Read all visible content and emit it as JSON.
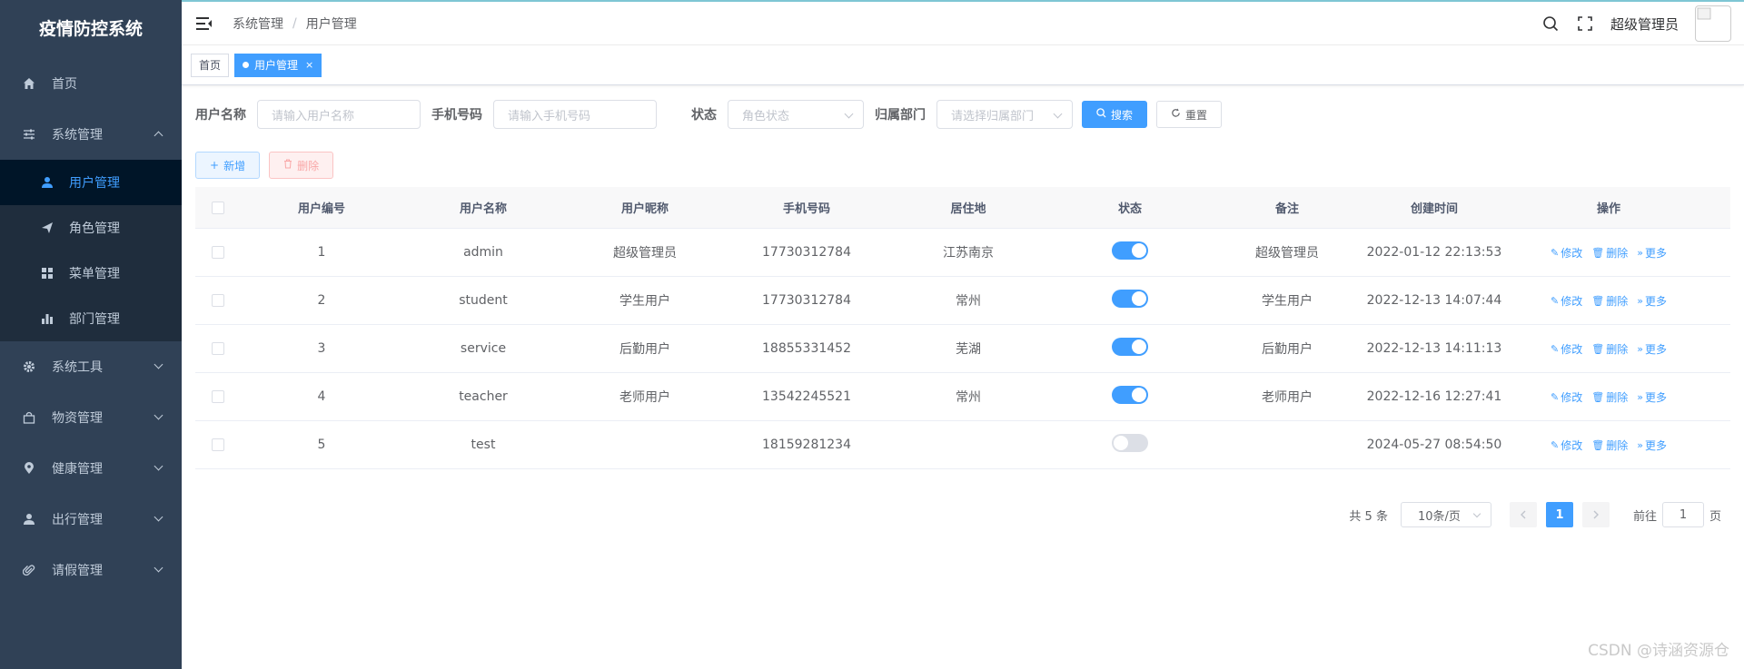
{
  "app": {
    "title": "疫情防控系统"
  },
  "sidebar": {
    "items": [
      {
        "label": "首页",
        "icon": "home-icon"
      },
      {
        "label": "系统管理",
        "icon": "sliders-icon",
        "expanded": true,
        "children": [
          {
            "label": "用户管理",
            "icon": "user-icon",
            "active": true
          },
          {
            "label": "角色管理",
            "icon": "send-icon"
          },
          {
            "label": "菜单管理",
            "icon": "grid-icon"
          },
          {
            "label": "部门管理",
            "icon": "bar-chart-icon"
          }
        ]
      },
      {
        "label": "系统工具",
        "icon": "gear-icon"
      },
      {
        "label": "物资管理",
        "icon": "bag-icon"
      },
      {
        "label": "健康管理",
        "icon": "location-icon"
      },
      {
        "label": "出行管理",
        "icon": "person-icon"
      },
      {
        "label": "请假管理",
        "icon": "paperclip-icon"
      }
    ]
  },
  "header": {
    "breadcrumb": [
      "系统管理",
      "用户管理"
    ],
    "username": "超级管理员"
  },
  "tags": [
    {
      "label": "首页",
      "active": false
    },
    {
      "label": "用户管理",
      "active": true,
      "close": "×"
    }
  ],
  "filters": {
    "username": {
      "label": "用户名称",
      "placeholder": "请输入用户名称"
    },
    "phone": {
      "label": "手机号码",
      "placeholder": "请输入手机号码"
    },
    "status": {
      "label": "状态",
      "placeholder": "角色状态"
    },
    "dept": {
      "label": "归属部门",
      "placeholder": "请选择归属部门"
    },
    "search_label": "搜索",
    "reset_label": "重置"
  },
  "toolbar": {
    "add_label": "新增",
    "delete_label": "删除"
  },
  "table": {
    "columns": [
      "用户编号",
      "用户名称",
      "用户昵称",
      "手机号码",
      "居住地",
      "状态",
      "备注",
      "创建时间",
      "操作"
    ],
    "rows": [
      {
        "id": "1",
        "name": "admin",
        "nick": "超级管理员",
        "phone": "17730312784",
        "addr": "江苏南京",
        "status": true,
        "remark": "超级管理员",
        "created": "2022-01-12 22:13:53"
      },
      {
        "id": "2",
        "name": "student",
        "nick": "学生用户",
        "phone": "17730312784",
        "addr": "常州",
        "status": true,
        "remark": "学生用户",
        "created": "2022-12-13 14:07:44"
      },
      {
        "id": "3",
        "name": "service",
        "nick": "后勤用户",
        "phone": "18855331452",
        "addr": "芜湖",
        "status": true,
        "remark": "后勤用户",
        "created": "2022-12-13 14:11:13"
      },
      {
        "id": "4",
        "name": "teacher",
        "nick": "老师用户",
        "phone": "13542245521",
        "addr": "常州",
        "status": true,
        "remark": "老师用户",
        "created": "2022-12-16 12:27:41"
      },
      {
        "id": "5",
        "name": "test",
        "nick": "",
        "phone": "18159281234",
        "addr": "",
        "status": false,
        "remark": "",
        "created": "2024-05-27 08:54:50"
      }
    ],
    "ops": {
      "edit": "修改",
      "delete": "删除",
      "more": "更多"
    }
  },
  "pagination": {
    "total_text": "共 5 条",
    "page_size": "10条/页",
    "current_page": "1",
    "goto_prefix": "前往",
    "goto_value": "1",
    "goto_suffix": "页"
  },
  "watermark": "CSDN @诗涵资源仓",
  "colors": {
    "sidebar": "#304156",
    "primary": "#409eff"
  }
}
